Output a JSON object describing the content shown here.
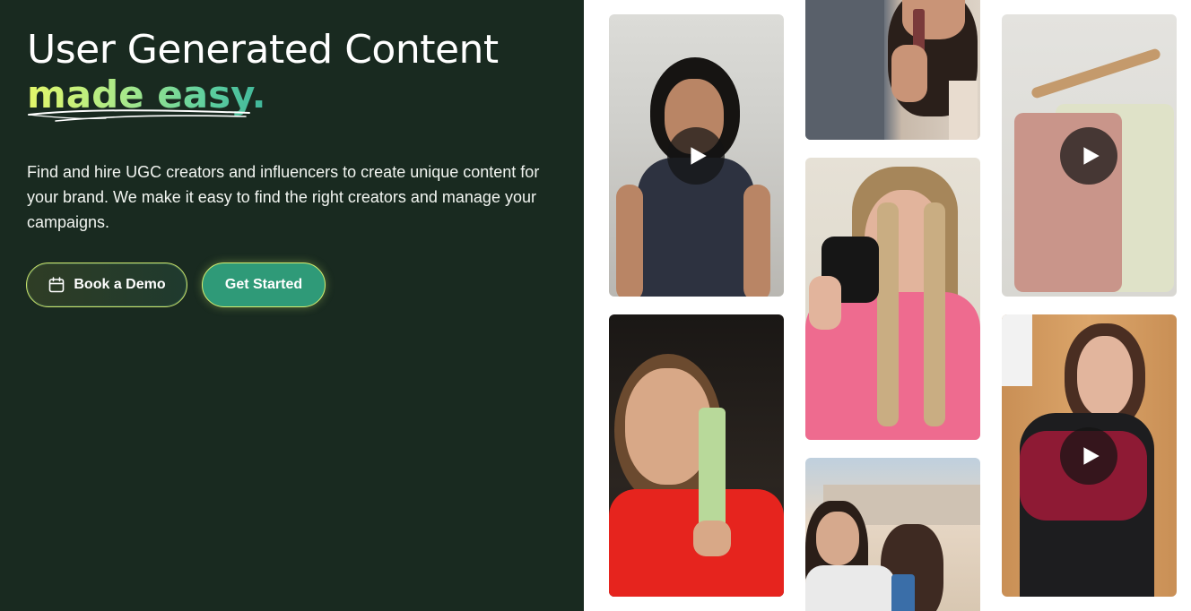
{
  "hero": {
    "headline": "User Generated Content",
    "headline_accent": "made easy.",
    "subtext": "Find and hire UGC creators and influencers to create unique content for your brand. We make it easy to find the right creators and manage your campaigns.",
    "book_demo_label": "Book a Demo",
    "get_started_label": "Get Started",
    "book_demo_icon": "calendar-icon"
  },
  "colors": {
    "background": "#192a20",
    "accent_start": "#e4f76a",
    "accent_end": "#3fb59a",
    "primary_button": "#2f9a78"
  },
  "gallery": {
    "videos": [
      {
        "name": "creator-curly-hair-video",
        "play_icon": "play-icon"
      },
      {
        "name": "creator-serum-bottle-video",
        "play_icon": null
      },
      {
        "name": "creator-clothes-hanger-video",
        "play_icon": "play-icon"
      },
      {
        "name": "creator-skincare-tube-video",
        "play_icon": null
      },
      {
        "name": "creator-braids-camera-mug-video",
        "play_icon": null
      },
      {
        "name": "creator-sweater-video",
        "play_icon": "play-icon"
      },
      {
        "name": "creator-dog-video",
        "play_icon": null
      }
    ]
  }
}
